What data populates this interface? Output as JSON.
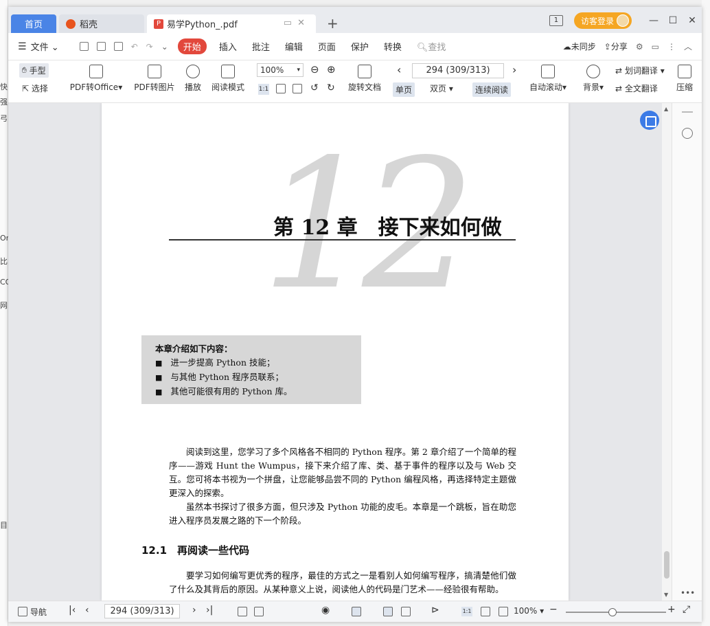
{
  "window": {
    "tabs": [
      {
        "label": "首页"
      },
      {
        "label": "稻壳"
      },
      {
        "label": "易学Python_.pdf"
      }
    ],
    "visitor_login": "访客登录",
    "page_badge": "1"
  },
  "menu": {
    "file": "文件",
    "start": "开始",
    "items": [
      "插入",
      "批注",
      "编辑",
      "页面",
      "保护",
      "转换"
    ],
    "search": "查找",
    "sync": "未同步",
    "share": "分享"
  },
  "ribbon": {
    "hand": "手型",
    "select": "选择",
    "pdf_to_office": "PDF转Office",
    "pdf_to_image": "PDF转图片",
    "play": "播放",
    "read_mode": "阅读模式",
    "zoom": "100%",
    "rotate": "旋转文档",
    "page_indicator": "294 (309/313)",
    "single_page": "单页",
    "double_page": "双页",
    "continuous": "连续阅读",
    "auto_scroll": "自动滚动",
    "background": "背景",
    "word_translate": "划词翻译",
    "full_translate": "全文翻译",
    "compress": "压缩"
  },
  "document": {
    "big_number": "12",
    "chapter_title": "第 12 章　接下来如何做",
    "intro_heading": "本章介绍如下内容：",
    "intro_items": [
      "进一步提高 Python 技能；",
      "与其他 Python 程序员联系；",
      "其他可能很有用的 Python 库。"
    ],
    "para1": "阅读到这里，您学习了多个风格各不相同的 Python 程序。第 2 章介绍了一个简单的程序——游戏 Hunt the Wumpus，接下来介绍了库、类、基于事件的程序以及与 Web 交互。您可将本书视为一个拼盘，让您能够品尝不同的 Python 编程风格，再选择特定主题做更深入的探索。",
    "para2": "虽然本书探讨了很多方面，但只涉及 Python 功能的皮毛。本章是一个跳板，旨在助您进入程序员发展之路的下一个阶段。",
    "section_title": "12.1　再阅读一些代码",
    "para3": "要学习如何编写更优秀的程序，最佳的方式之一是看别人如何编写程序，搞清楚他们做了什么及其背后的原因。从某种意义上说，阅读他人的代码是门艺术——经验很有帮助。"
  },
  "statusbar": {
    "nav": "导航",
    "page_indicator": "294 (309/313)",
    "zoom": "100%"
  },
  "background_app": {
    "snippets": [
      "快",
      "强",
      "弓",
      "Or",
      "比",
      "CO",
      "网",
      "目"
    ]
  }
}
